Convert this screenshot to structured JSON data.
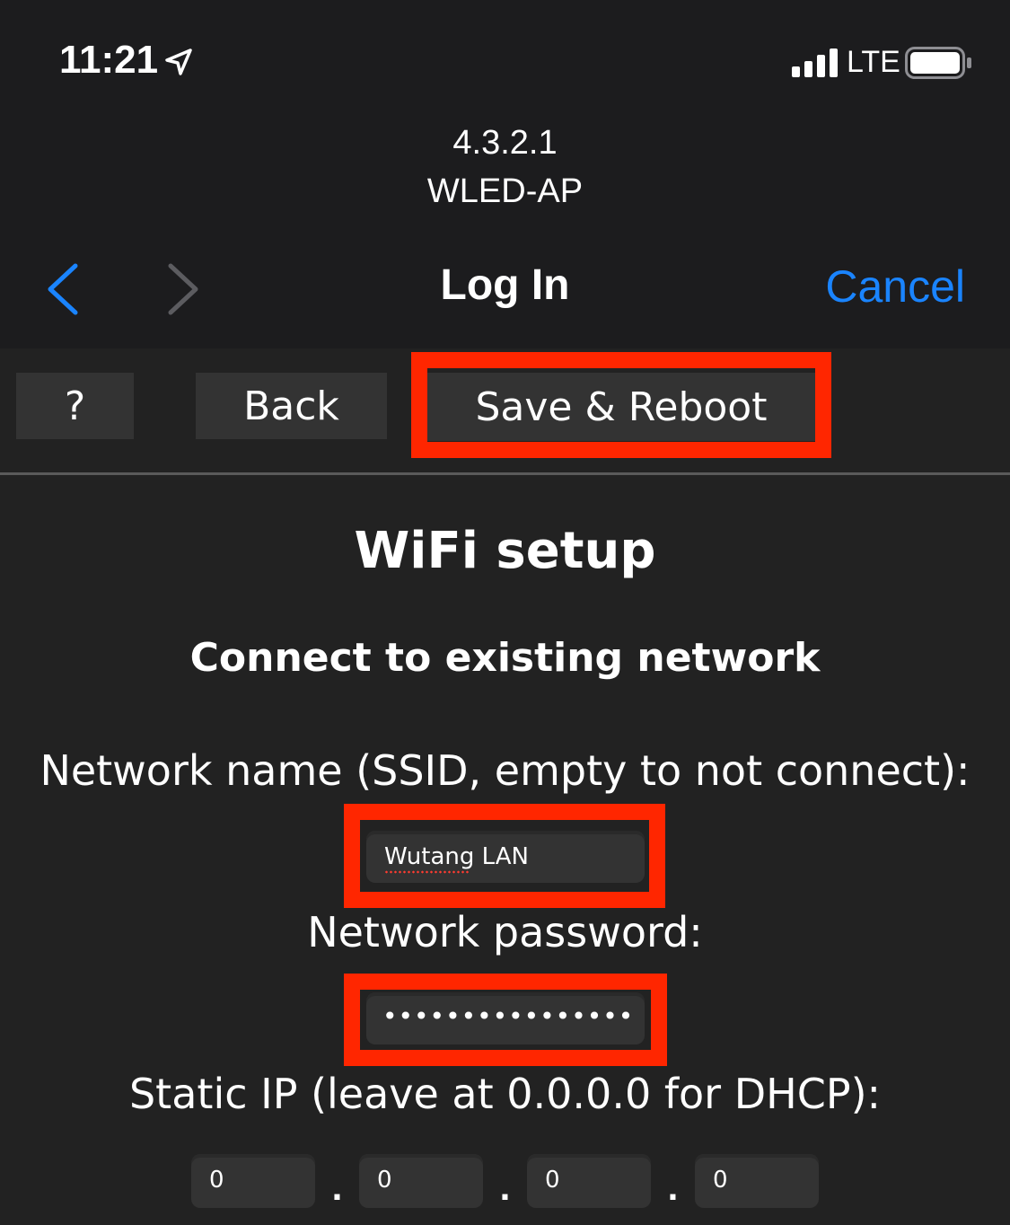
{
  "status_bar": {
    "time": "11:21",
    "network": "LTE"
  },
  "browser": {
    "host_version": "4.3.2.1",
    "host_name": "WLED-AP",
    "title": "Log In",
    "cancel_label": "Cancel"
  },
  "toolbar": {
    "help_label": "?",
    "back_label": "Back",
    "save_label": "Save & Reboot"
  },
  "page": {
    "heading": "WiFi setup",
    "subheading": "Connect to existing network",
    "ssid_label": "Network name (SSID, empty to not connect):",
    "ssid_value": "Wutang LAN",
    "password_label": "Network password:",
    "password_value": "••••••••••••••••",
    "static_ip_label": "Static IP (leave at 0.0.0.0 for DHCP):",
    "static_ip": [
      "0",
      "0",
      "0",
      "0"
    ],
    "ip_separator": "."
  },
  "colors": {
    "accent": "#1a84ff",
    "highlight": "#ff2600",
    "background": "#222222",
    "field": "#333333"
  }
}
